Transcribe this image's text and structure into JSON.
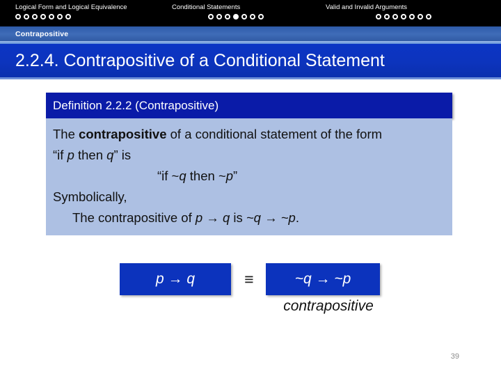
{
  "topnav": {
    "groups": [
      {
        "label": "Logical Form and Logical Equivalence",
        "dots": 7,
        "active_index": -1
      },
      {
        "label": "Conditional Statements",
        "dots": 7,
        "active_index": 3
      },
      {
        "label": "Valid and Invalid Arguments",
        "dots": 7,
        "active_index": -1
      }
    ]
  },
  "subband": {
    "label": "Contrapositive"
  },
  "slide": {
    "title": "2.2.4. Contrapositive of a Conditional Statement"
  },
  "definition": {
    "header": "Definition 2.2.2 (Contrapositive)",
    "line1_a": "The ",
    "line1_b": "contrapositive",
    "line1_c": " of a conditional statement of the form",
    "line2_a": "“if ",
    "line2_p": "p",
    "line2_b": " then ",
    "line2_q": "q",
    "line2_c": "” is",
    "line3": "“if ~q then ~p”",
    "line3_a": "“if ~",
    "line3_q": "q",
    "line3_b": " then ~",
    "line3_p": "p",
    "line3_c": "”",
    "line4": "Symbolically,",
    "line5_a": "The contrapositive of ",
    "line5_pq": "p → q",
    "line5_b": " is ",
    "line5_qp": "~q → ~p",
    "line5_c": "."
  },
  "formulas": {
    "left_box": "p → q",
    "equiv_symbol": "≡",
    "right_box": "~q → ~p",
    "caption": "contrapositive"
  },
  "footer": {
    "page_number": "39"
  },
  "colors": {
    "nav_background": "#000000",
    "subband_blue": "#3f6cb8",
    "title_blue": "#0c34bd",
    "definition_header": "#0a1ba8",
    "definition_body": "#adc0e3",
    "formula_box": "#0c33bd",
    "page_number": "#8c8c8c"
  }
}
